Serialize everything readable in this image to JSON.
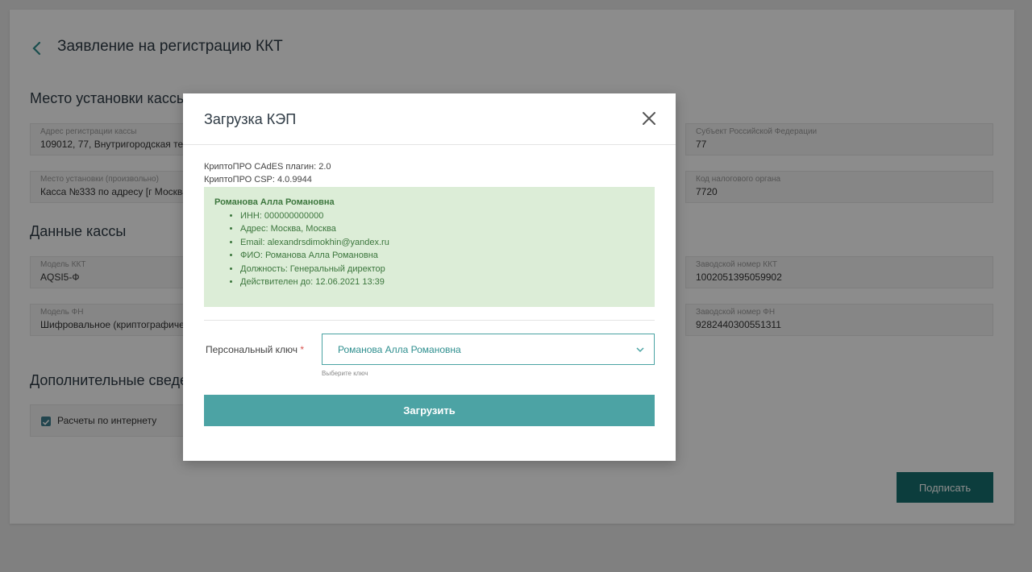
{
  "page": {
    "title": "Заявление на регистрацию ККТ",
    "sections": {
      "place": "Место установки кассы",
      "data": "Данные кассы",
      "extra": "Дополнительные сведения"
    },
    "fields": {
      "reg_address": {
        "label": "Адрес регистрации кассы",
        "value": "109012, 77, Внутригородская территория"
      },
      "region": {
        "label": "Субъект Российской Федерации",
        "value": "77"
      },
      "install_place": {
        "label": "Место установки (произвольно)",
        "value": "Касса №333 по адресу [г Москва]"
      },
      "tax_code": {
        "label": "Код налогового органа",
        "value": "7720"
      },
      "kkt_model": {
        "label": "Модель ККТ",
        "value": "AQSI5-Ф"
      },
      "kkt_serial": {
        "label": "Заводской номер ККТ",
        "value": "1002051395059902"
      },
      "fn_model": {
        "label": "Модель ФН",
        "value": "Шифровальное (криптографическое)"
      },
      "fn_serial": {
        "label": "Заводской номер ФН",
        "value": "9282440300551311"
      }
    },
    "internet_checkbox": {
      "label": "Расчеты по интернету",
      "checked": true
    },
    "sign_button": "Подписать"
  },
  "modal": {
    "title": "Загрузка КЭП",
    "plugin_line": "КриптоПРО CAdES плагин: 2.0",
    "csp_line": "КриптоПРО CSP: 4.0.9944",
    "cert": {
      "name": "Романова Алла Романовна",
      "items": [
        "ИНН: 000000000000",
        "Адрес: Москва, Москва",
        "Email: alexandrsdimokhin@yandex.ru",
        "ФИО: Романова Алла Романовна",
        "Должность: Генеральный директор",
        "Действителен до: 12.06.2021 13:39"
      ]
    },
    "key_label": "Персональный ключ",
    "required_mark": "*",
    "key_value": "Романова Алла Романовна",
    "key_hint": "Выберите ключ",
    "load_button": "Загрузить"
  },
  "colors": {
    "accent": "#4ca3a4",
    "sign_button": "#17706f",
    "cert_bg": "#dcedd7",
    "cert_text": "#3c763d"
  }
}
